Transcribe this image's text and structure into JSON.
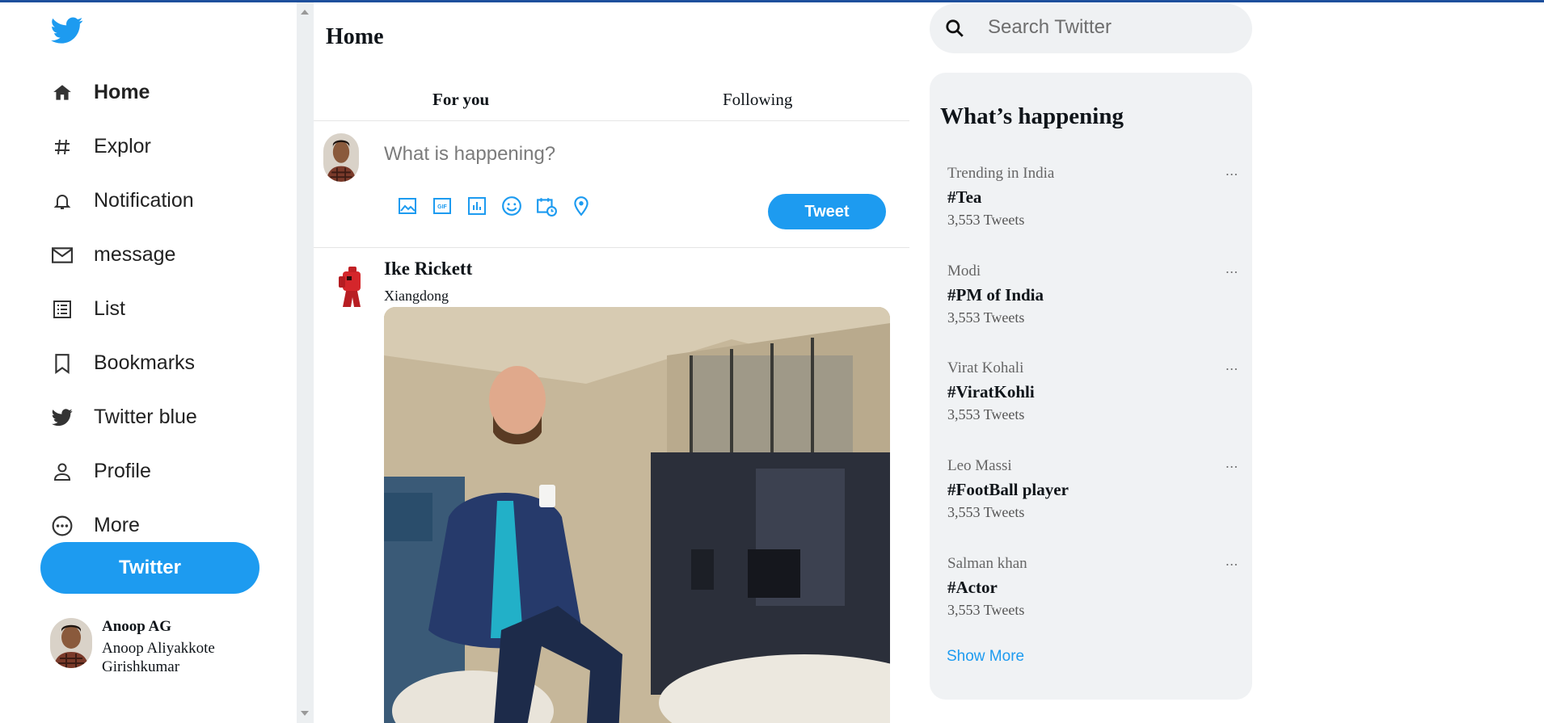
{
  "sidebar": {
    "logo_icon": "twitter-bird-icon",
    "items": [
      {
        "label": "Home",
        "icon": "home-icon"
      },
      {
        "label": "Explor",
        "icon": "hash-icon"
      },
      {
        "label": "Notification",
        "icon": "bell-icon"
      },
      {
        "label": "message",
        "icon": "mail-icon"
      },
      {
        "label": "List",
        "icon": "list-icon"
      },
      {
        "label": "Bookmarks",
        "icon": "bookmark-icon"
      },
      {
        "label": "Twitter blue",
        "icon": "twitter-bird-icon"
      },
      {
        "label": "Profile",
        "icon": "person-icon"
      },
      {
        "label": "More",
        "icon": "more-circle-icon"
      }
    ],
    "tweet_button": "Twitter",
    "profile": {
      "name": "Anoop AG",
      "handle": "Anoop Aliyakkote Girishkumar"
    }
  },
  "main": {
    "title": "Home",
    "tabs": [
      {
        "label": "For you"
      },
      {
        "label": "Following"
      }
    ],
    "compose": {
      "placeholder": "What is happening?",
      "icons": [
        "image-icon",
        "gif-icon",
        "poll-icon",
        "emoji-icon",
        "schedule-icon",
        "location-icon"
      ],
      "tweet_button": "Tweet"
    },
    "post": {
      "name": "Ike Rickett",
      "handle": "Xiangdong"
    }
  },
  "right": {
    "search_placeholder": "Search Twitter",
    "trends_title": "What’s happening",
    "trends": [
      {
        "category": "Trending in India",
        "tag": "#Tea",
        "count": "3,553 Tweets"
      },
      {
        "category": "Modi",
        "tag": "#PM of India",
        "count": "3,553 Tweets"
      },
      {
        "category": "Virat Kohali",
        "tag": "#ViratKohli",
        "count": "3,553 Tweets"
      },
      {
        "category": "Leo Massi",
        "tag": "#FootBall player",
        "count": "3,553 Tweets"
      },
      {
        "category": "Salman khan",
        "tag": "#Actor",
        "count": "3,553 Tweets"
      }
    ],
    "more_label": "...",
    "show_more": "Show More"
  },
  "colors": {
    "accent": "#1d9bf0",
    "top_border": "#1d4f9c"
  }
}
